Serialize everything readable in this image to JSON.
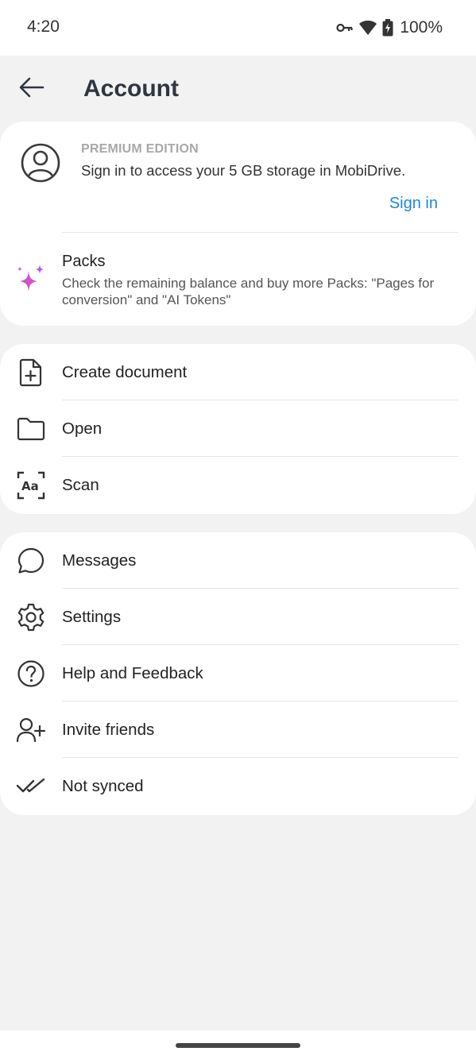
{
  "status_bar": {
    "time": "4:20",
    "battery": "100%",
    "icons": [
      "vpn-key-icon",
      "wifi-icon",
      "battery-charging-icon"
    ]
  },
  "app_bar": {
    "title": "Account",
    "back_icon": "arrow-back-icon"
  },
  "account": {
    "edition_label": "PREMIUM EDITION",
    "description": "Sign in to access your 5 GB storage in MobiDrive.",
    "sign_in_label": "Sign in"
  },
  "packs": {
    "title": "Packs",
    "description": "Check the remaining balance and buy more Packs: \"Pages for conversion\" and \"AI Tokens\""
  },
  "documents_menu": [
    {
      "label": "Create document",
      "icon": "new-document-icon"
    },
    {
      "label": "Open",
      "icon": "folder-icon"
    },
    {
      "label": "Scan",
      "icon": "scan-text-icon"
    }
  ],
  "misc_menu": [
    {
      "label": "Messages",
      "icon": "chat-bubble-icon"
    },
    {
      "label": "Settings",
      "icon": "gear-icon"
    },
    {
      "label": "Help and Feedback",
      "icon": "help-circle-icon"
    },
    {
      "label": "Invite friends",
      "icon": "add-user-icon"
    },
    {
      "label": "Not synced",
      "icon": "double-check-icon"
    }
  ],
  "colors": {
    "accent": "#1e88d8",
    "background": "#f2f2f2",
    "card": "#ffffff"
  }
}
